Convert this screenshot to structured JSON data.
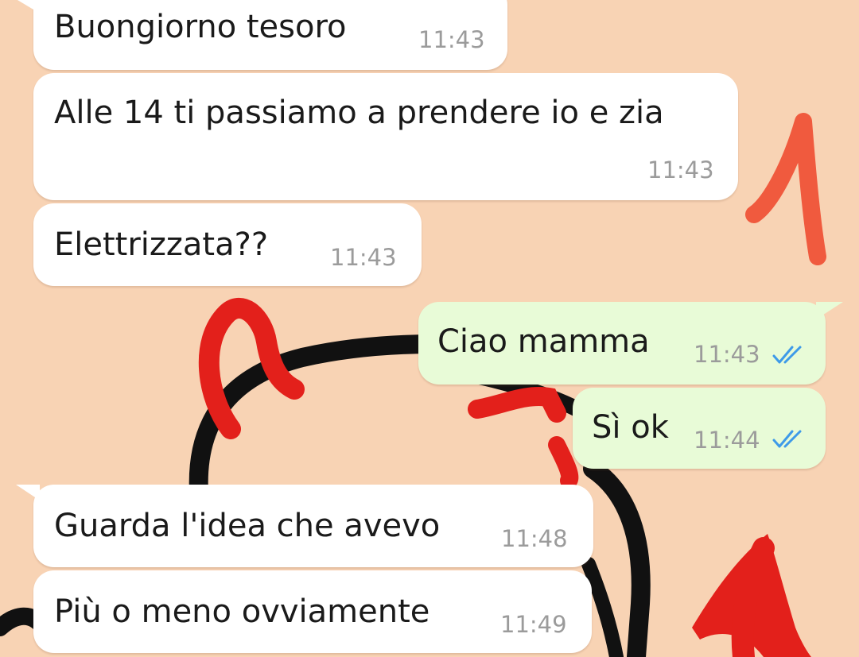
{
  "messages": [
    {
      "text": "Buongiorno tesoro",
      "time": "11:43"
    },
    {
      "text": "Alle 14 ti passiamo a prendere io e zia",
      "time": "11:43"
    },
    {
      "text": "Elettrizzata??",
      "time": "11:43"
    },
    {
      "text": "Ciao mamma",
      "time": "11:43",
      "status": "double-check-read-icon"
    },
    {
      "text": "Sì ok",
      "time": "11:44",
      "status": "double-check-read-icon"
    },
    {
      "text": "Guarda l'idea che avevo",
      "time": "11:48"
    },
    {
      "text": "Più o meno ovviamente",
      "time": "11:49"
    }
  ],
  "colors": {
    "wallpaper": "#f8d3b4",
    "incoming_bubble": "#ffffff",
    "outgoing_bubble": "#e8fbd7",
    "timestamp": "#9b9b9b",
    "read_ticks": "#3e9ae8",
    "annotation": "#f05a3e",
    "devil_horns": "#e3201b",
    "wallpaper_outline": "#111111"
  }
}
